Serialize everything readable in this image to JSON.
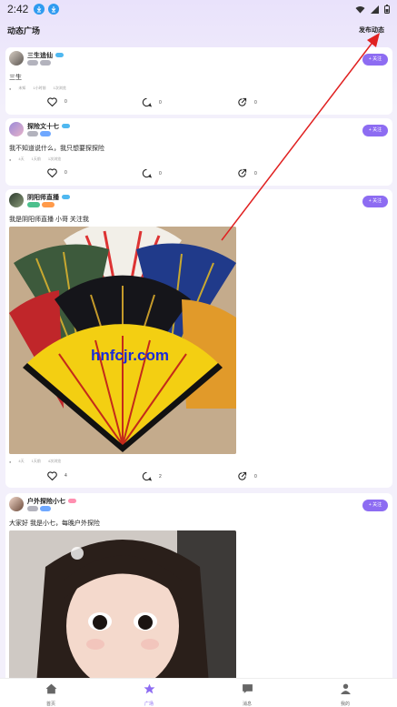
{
  "status_bar": {
    "time": "2:42"
  },
  "header": {
    "title": "动态广场",
    "post_label": "发布动态"
  },
  "posts": [
    {
      "username": "三生追仙",
      "tags": [
        "",
        ""
      ],
      "follow_label": "+ 关注",
      "text": "三生",
      "meta": [
        "未知",
        "1小时前",
        "1次浏览"
      ],
      "likes": "0",
      "comments": "0",
      "shares": "0"
    },
    {
      "username": "探险文十七",
      "tags": [
        "",
        ""
      ],
      "follow_label": "+ 关注",
      "text": "我不知道说什么，我只想要探探险",
      "meta": [
        "4天",
        "1天前",
        "1次浏览"
      ],
      "likes": "0",
      "comments": "0",
      "shares": "0"
    },
    {
      "username": "阴阳师直播",
      "tags": [
        "",
        ""
      ],
      "follow_label": "+ 关注",
      "text": "我是阴阳师直播 小哥 关注我",
      "watermark": "hnfcjr.com",
      "meta": [
        "4天",
        "1天前",
        "4次浏览"
      ],
      "likes": "4",
      "comments": "2",
      "shares": "0"
    },
    {
      "username": "户外探险小七",
      "tags": [
        "",
        ""
      ],
      "follow_label": "+ 关注",
      "text": "大家好 我是小七，每晚户外探险"
    }
  ],
  "tabbar": {
    "items": [
      {
        "label": "首页",
        "icon": "home-icon"
      },
      {
        "label": "广场",
        "icon": "square-icon"
      },
      {
        "label": "消息",
        "icon": "message-icon"
      },
      {
        "label": "我的",
        "icon": "profile-icon"
      }
    ]
  },
  "colors": {
    "accent": "#8d6cf2",
    "arrow": "#e02020",
    "background": "#f3f0fb"
  }
}
